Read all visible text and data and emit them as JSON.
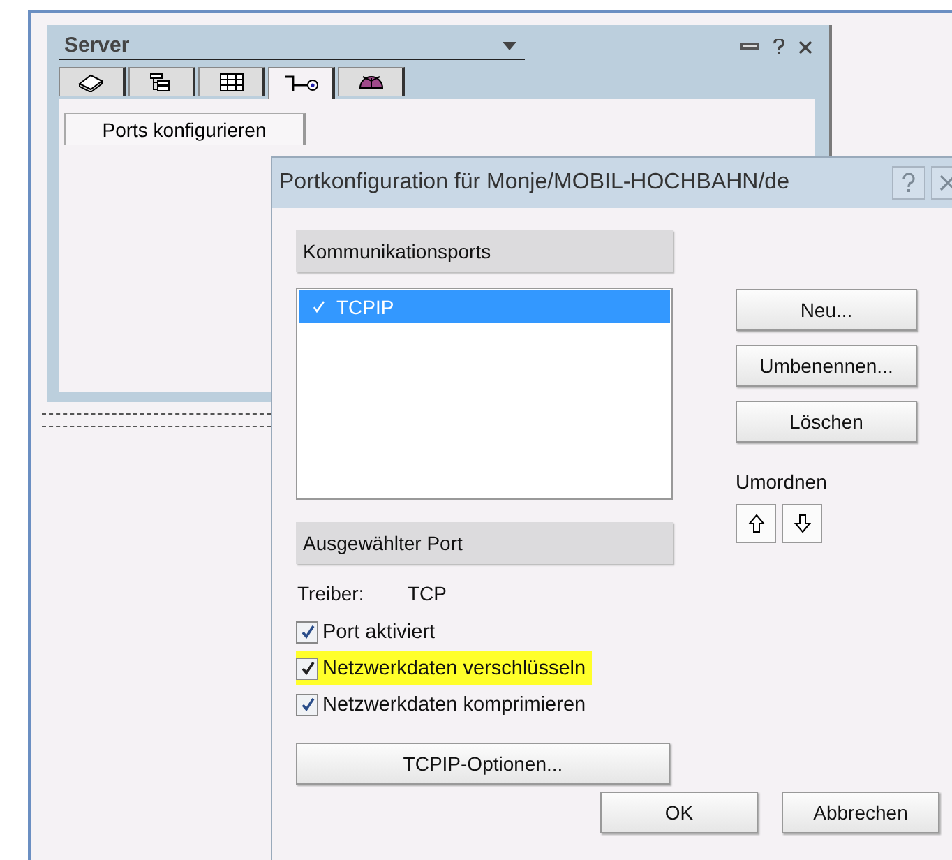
{
  "server_panel": {
    "title": "Server",
    "tabs": [
      {
        "kind": "book",
        "selected": false
      },
      {
        "kind": "tree",
        "selected": false
      },
      {
        "kind": "columns",
        "selected": false
      },
      {
        "kind": "key",
        "selected": true
      },
      {
        "kind": "dish",
        "selected": false
      }
    ],
    "subtab": "Ports konfigurieren"
  },
  "dialog": {
    "title": "Portkonfiguration für Monje/MOBIL-HOCHBAHN/de",
    "ports_heading": "Kommunikationsports",
    "ports": [
      {
        "label": "TCPIP",
        "selected": true,
        "checked": true
      }
    ],
    "side_buttons": [
      "Neu...",
      "Umbenennen...",
      "Löschen"
    ],
    "reorder_label": "Umordnen",
    "selected_heading": "Ausgewählter Port",
    "driver_label": "Treiber:",
    "driver_value": "TCP",
    "options": [
      {
        "label": "Port aktiviert",
        "checked": true,
        "highlighted": false
      },
      {
        "label": "Netzwerkdaten verschlüsseln",
        "checked": true,
        "highlighted": true
      },
      {
        "label": "Netzwerkdaten komprimieren",
        "checked": true,
        "highlighted": false
      }
    ],
    "options_button": "TCPIP-Optionen...",
    "buttons": [
      "OK",
      "Abbrechen"
    ]
  }
}
